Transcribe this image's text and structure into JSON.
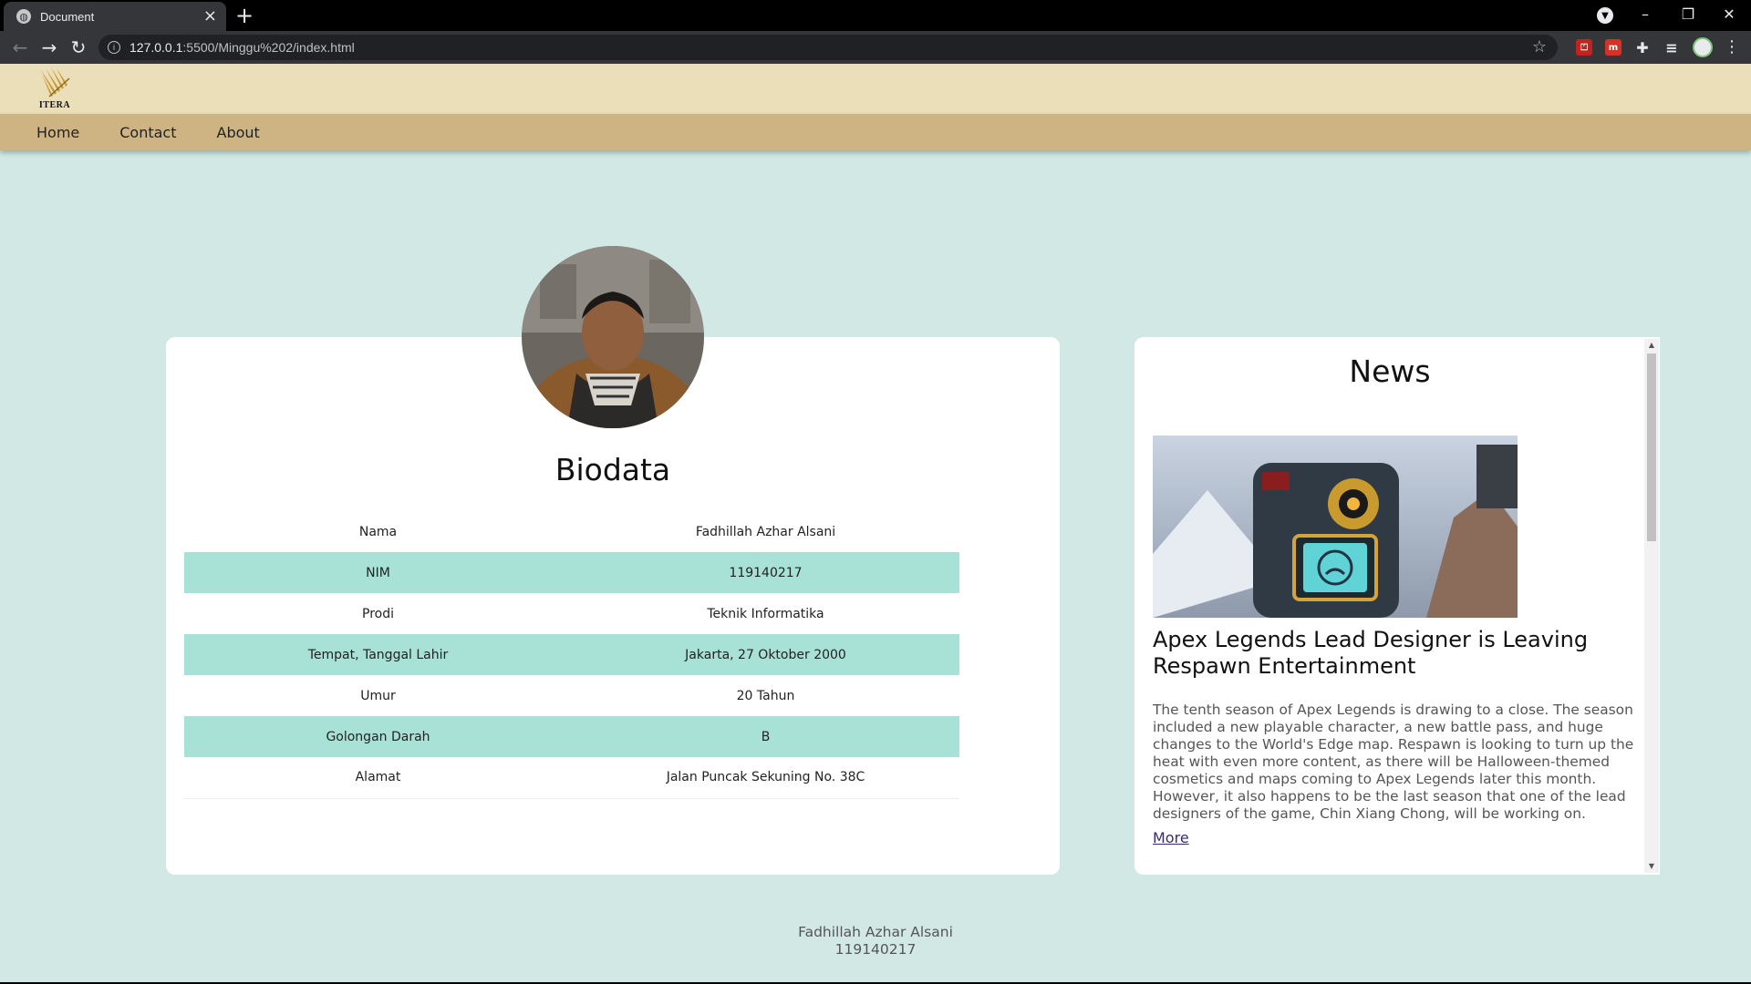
{
  "browser": {
    "tab_title": "Document",
    "tab_close": "×",
    "new_tab": "+",
    "url_host": "127.0.0.1",
    "url_path": ":5500/Minggu%202/index.html",
    "window_controls": [
      "–",
      "❐",
      "✕"
    ]
  },
  "site": {
    "logo_text": "ITERA",
    "nav": [
      "Home",
      "Contact",
      "About"
    ]
  },
  "biodata": {
    "title": "Biodata",
    "rows": [
      {
        "label": "Nama",
        "value": "Fadhillah Azhar Alsani"
      },
      {
        "label": "NIM",
        "value": "119140217"
      },
      {
        "label": "Prodi",
        "value": "Teknik Informatika"
      },
      {
        "label": "Tempat, Tanggal Lahir",
        "value": "Jakarta, 27 Oktober 2000"
      },
      {
        "label": "Umur",
        "value": "20 Tahun"
      },
      {
        "label": "Golongan Darah",
        "value": "B"
      },
      {
        "label": "Alamat",
        "value": "Jalan Puncak Sekuning No. 38C"
      }
    ]
  },
  "news": {
    "title": "News",
    "headline": "Apex Legends Lead Designer is Leaving Respawn Entertainment",
    "body": "The tenth season of Apex Legends is drawing to a close. The season included a new playable character, a new battle pass, and huge changes to the World's Edge map. Respawn is looking to turn up the heat with even more content, as there will be Halloween-themed cosmetics and maps coming to Apex Legends later this month. However, it also happens to be the last season that one of the lead designers of the game, Chin Xiang Chong, will be working on.",
    "more": "More"
  },
  "footer": {
    "name": "Fadhillah Azhar Alsani",
    "nim": "119140217"
  }
}
